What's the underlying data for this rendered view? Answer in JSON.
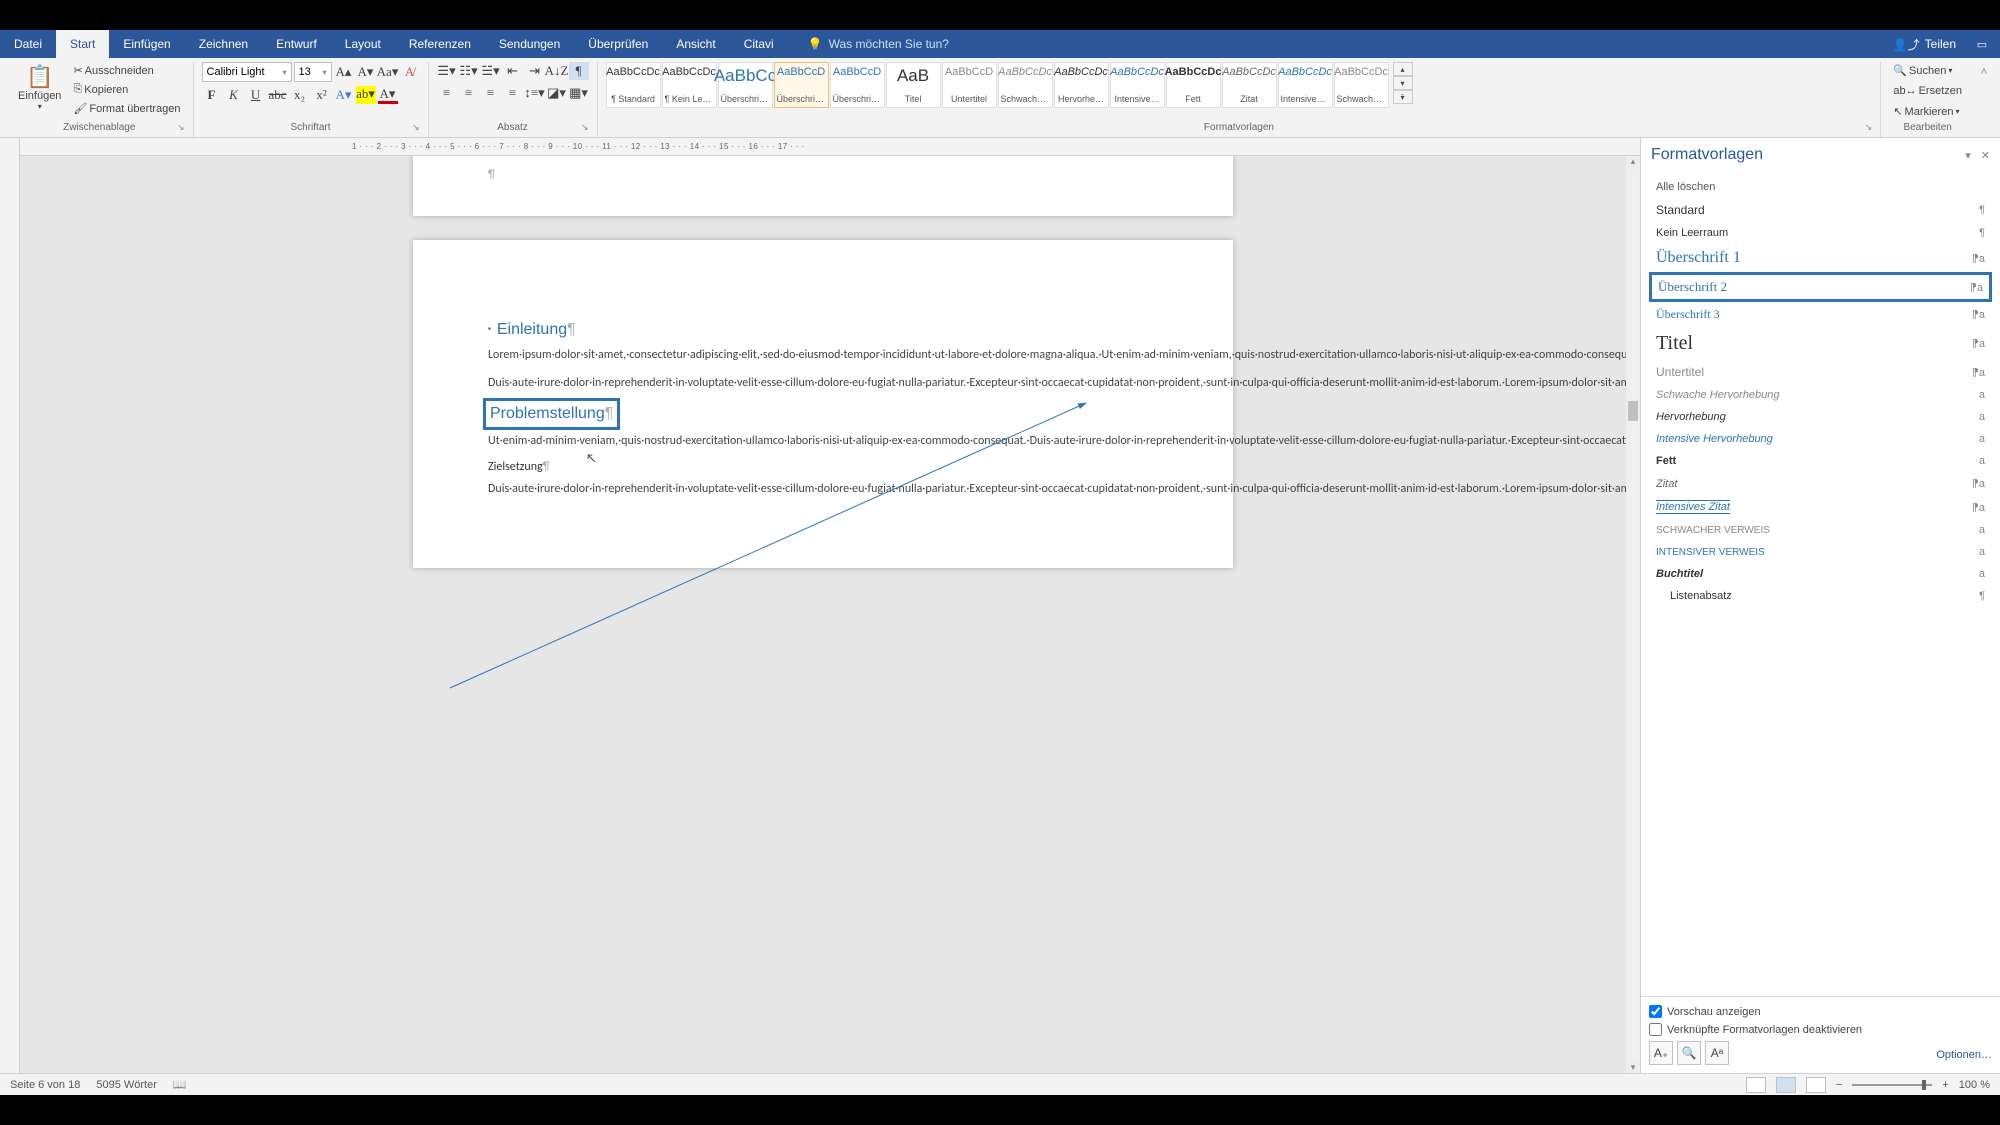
{
  "titlebar": {
    "tabs": [
      {
        "label": "Datei",
        "key": "file"
      },
      {
        "label": "Start",
        "key": "start",
        "active": true
      },
      {
        "label": "Einfügen",
        "key": "insert"
      },
      {
        "label": "Zeichnen",
        "key": "draw"
      },
      {
        "label": "Entwurf",
        "key": "design"
      },
      {
        "label": "Layout",
        "key": "layout"
      },
      {
        "label": "Referenzen",
        "key": "ref"
      },
      {
        "label": "Sendungen",
        "key": "mail"
      },
      {
        "label": "Überprüfen",
        "key": "review"
      },
      {
        "label": "Ansicht",
        "key": "view"
      },
      {
        "label": "Citavi",
        "key": "citavi"
      }
    ],
    "tellme": "Was möchten Sie tun?",
    "share": "Teilen"
  },
  "ribbon": {
    "clipboard": {
      "label": "Zwischenablage",
      "paste": "Einfügen",
      "cut": "Ausschneiden",
      "copy": "Kopieren",
      "format": "Format übertragen"
    },
    "font": {
      "label": "Schriftart",
      "family": "Calibri Light",
      "size": "13"
    },
    "paragraph": {
      "label": "Absatz"
    },
    "styles": {
      "label": "Formatvorlagen",
      "items": [
        {
          "sample": "AaBbCcDc",
          "name": "¶ Standard",
          "color": "#333"
        },
        {
          "sample": "AaBbCcDc",
          "name": "¶ Kein Leer…",
          "color": "#333"
        },
        {
          "sample": "AaBbCc",
          "name": "Überschrif…",
          "color": "#2e74b5",
          "big": true
        },
        {
          "sample": "AaBbCcD",
          "name": "Überschrif…",
          "color": "#2e74b5",
          "sel": true
        },
        {
          "sample": "AaBbCcD",
          "name": "Überschrif…",
          "color": "#2e74b5"
        },
        {
          "sample": "AaB",
          "name": "Titel",
          "color": "#333",
          "big": true
        },
        {
          "sample": "AaBbCcD",
          "name": "Untertitel",
          "color": "#888"
        },
        {
          "sample": "AaBbCcDc",
          "name": "Schwache…",
          "color": "#888",
          "italic": true
        },
        {
          "sample": "AaBbCcDc",
          "name": "Hervorhe…",
          "color": "#333",
          "italic": true
        },
        {
          "sample": "AaBbCcDc",
          "name": "Intensive…",
          "color": "#2e74b5",
          "italic": true
        },
        {
          "sample": "AaBbCcDc",
          "name": "Fett",
          "color": "#333",
          "bold": true
        },
        {
          "sample": "AaBbCcDc",
          "name": "Zitat",
          "color": "#666",
          "italic": true
        },
        {
          "sample": "AaBbCcDc",
          "name": "Intensives…",
          "color": "#2e74b5",
          "italic": true
        },
        {
          "sample": "AaBbCcDc",
          "name": "Schwache…",
          "color": "#888"
        }
      ]
    },
    "editing": {
      "label": "Bearbeiten",
      "find": "Suchen",
      "replace": "Ersetzen",
      "select": "Markieren"
    }
  },
  "ruler": "1 · · · 2 · · · 3 · · · 4 · · · 5 · · · 6 · · · 7 · · · 8 · · · 9 · · · 10 · · · 11 · · · 12 · · · 13 · · · 14 · · · 15 · · · 16 · · · 17 · · ·",
  "document": {
    "h1": "Einleitung",
    "p1a": "Lorem·ipsum·dolor·sit·amet,·consectetur·adipiscing·elit,·sed·do·eiusmod·tempor·incididunt·ut·labore·et·dolore·magna·aliqua.·Ut·enim·ad·minim·veniam,·quis·nostrud·exercitation·ullamco·laboris·nisi·ut·aliquip·ex·ea·commodo·consequat.·Duis·aute·irure·dolor·in·reprehenderit·in·voluptate·velit·esse·cillum·dolore·eu·fugiat·nulla·pariatur.·Excepteur·sint·occaecat·cupidatat·non·proident,·sunt·in·culpa·qui·officia·deserunt·mollit·anim·id·est·laborum.·Lorem·ipsum·dolor·sit·amet,·consectetur·adipiscing·elit,·sed·do·eiusmod·tempor·incididunt·ut·labore·et·dolore·magna·aliqua.·Ut·enim·ad·minim·veniam,·quis·nostrud·exercitation·ullamco·laboris·nisi·ut·aliquip·ex·ea·commodo·consequat.·",
    "p1b": "Duis·aute·irure·dolor·in·reprehenderit·in·voluptate·velit·esse·cillum·dolore·eu·fugiat·nulla·pariatur.·Excepteur·sint·occaecat·cupidatat·non·proident,·sunt·in·culpa·qui·officia·deserunt·mollit·anim·id·est·laborum.·Lorem·ipsum·dolor·sit·amet,·consectetur·adipiscing·elit,·sed·do·eiusmod·tempor·incididunt·ut·labore·et·dolore·magna·aliqua.·Ut·enim·ad·minim·veniam,·quis·nostrud·exercitation·ullamco·laboris·nisi·ut·aliquip·ex·ea·commodo·consequat.·",
    "h2": "Problemstellung",
    "p2": "Ut·enim·ad·minim·veniam,·quis·nostrud·exercitation·ullamco·laboris·nisi·ut·aliquip·ex·ea·commodo·consequat.·Duis·aute·irure·dolor·in·reprehenderit·in·voluptate·velit·esse·cillum·dolore·eu·fugiat·nulla·pariatur.·Excepteur·sint·occaecat·cupidatat·non·proident,·sunt·in·culpa·qui·officia·deserunt·mollit·anim·id·est·laborum.·Lorem·ipsum·dolor·sit·amet,·consectetur·adipiscing·elit,·sed·do·eiusmod·tempor·incididunt·ut·labore·et·dolore·magna·aliqua.·Ut·enim·ad·minim·veniam,·quis·nostrud·exercitation·ullamco·laboris·nisi·ut·aliquip·ex·ea·commodo·consequat.·Duis·aute·irure·dolor·in·reprehenderit·in·voluptate·velit·esse·cillum·dolore·eu·fugiat·nulla·pariatur.·Excepteur·sint·occaecat·cupidatat·non·proident,·sunt·in·culpa·qui·officia·deserunt·mollit·anim·id·est·laborum.·Lorem·ipsum·dolor·sit·amet,·consectetur·adipiscing·elit,·sed·do·eiusmod·tempor·incididunt·ut·labore·et·dolore·magna·aliqua.·",
    "h3": "Zielsetzung",
    "p3": "Duis·aute·irure·dolor·in·reprehenderit·in·voluptate·velit·esse·cillum·dolore·eu·fugiat·nulla·pariatur.·Excepteur·sint·occaecat·cupidatat·non·proident,·sunt·in·culpa·qui·officia·deserunt·mollit·anim·id·est·laborum.·Lorem·ipsum·dolor·sit·amet,·consectetur·adipiscing·elit,·sed·do·eiusmod·tempor·incididunt·ut·labore·et·dolore·magna·aliqua.·Ut·enim·ad·minim·veniam,·quis·nostrud·exercitation·ullamco·laboris·nisi·ut·aliquip·ex·ea·commodo·consequat.·Duis·aute·irure·dolor·in·reprehenderit·in·"
  },
  "stylespane": {
    "title": "Formatvorlagen",
    "items": [
      {
        "label": "Alle löschen",
        "mark": "",
        "style": "font-size:11px;color:#555;"
      },
      {
        "label": "Standard",
        "mark": "¶",
        "style": "font-size:12px;"
      },
      {
        "label": "Kein Leerraum",
        "mark": "¶",
        "style": "font-size:11px;"
      },
      {
        "label": "Überschrift 1",
        "mark": "⁋a",
        "style": "font-family:'Calibri Light';color:#2e74b5;font-size:16px;"
      },
      {
        "label": "Überschrift 2",
        "mark": "⁋a",
        "style": "font-family:'Calibri Light';color:#2e74b5;font-size:13px;",
        "highlighted": true
      },
      {
        "label": "Überschrift 3",
        "mark": "⁋a",
        "style": "font-family:'Calibri Light';color:#2e74b5;font-size:12px;"
      },
      {
        "label": "Titel",
        "mark": "⁋a",
        "style": "font-family:'Calibri Light';font-size:20px;"
      },
      {
        "label": "Untertitel",
        "mark": "⁋a",
        "style": "color:#888;font-size:12px;"
      },
      {
        "label": "Schwache Hervorhebung",
        "mark": "a",
        "style": "color:#888;font-style:italic;font-size:11px;"
      },
      {
        "label": "Hervorhebung",
        "mark": "a",
        "style": "font-style:italic;font-size:11px;"
      },
      {
        "label": "Intensive Hervorhebung",
        "mark": "a",
        "style": "color:#2e74b5;font-style:italic;font-size:11px;"
      },
      {
        "label": "Fett",
        "mark": "a",
        "style": "font-weight:bold;font-size:11px;"
      },
      {
        "label": "Zitat",
        "mark": "⁋a",
        "style": "color:#666;font-style:italic;text-align:center;font-size:11px;"
      },
      {
        "label": "Intensives Zitat",
        "mark": "⁋a",
        "style": "color:#2e74b5;font-style:italic;text-align:center;font-size:11px;border-top:1px solid #2e74b5;border-bottom:1px solid #2e74b5;"
      },
      {
        "label": "SCHWACHER VERWEIS",
        "mark": "a",
        "style": "color:#888;font-size:10px;font-variant:small-caps;"
      },
      {
        "label": "INTENSIVER VERWEIS",
        "mark": "a",
        "style": "color:#2e74b5;font-size:10px;font-variant:small-caps;"
      },
      {
        "label": "Buchtitel",
        "mark": "a",
        "style": "font-weight:bold;font-style:italic;font-size:11px;"
      },
      {
        "label": "Listenabsatz",
        "mark": "¶",
        "style": "font-size:11px;padding-left:14px;"
      }
    ],
    "preview": "Vorschau anzeigen",
    "linked": "Verknüpfte Formatvorlagen deaktivieren",
    "options": "Optionen…"
  },
  "statusbar": {
    "page": "Seite 6 von 18",
    "words": "5095 Wörter",
    "zoom": "100 %"
  }
}
